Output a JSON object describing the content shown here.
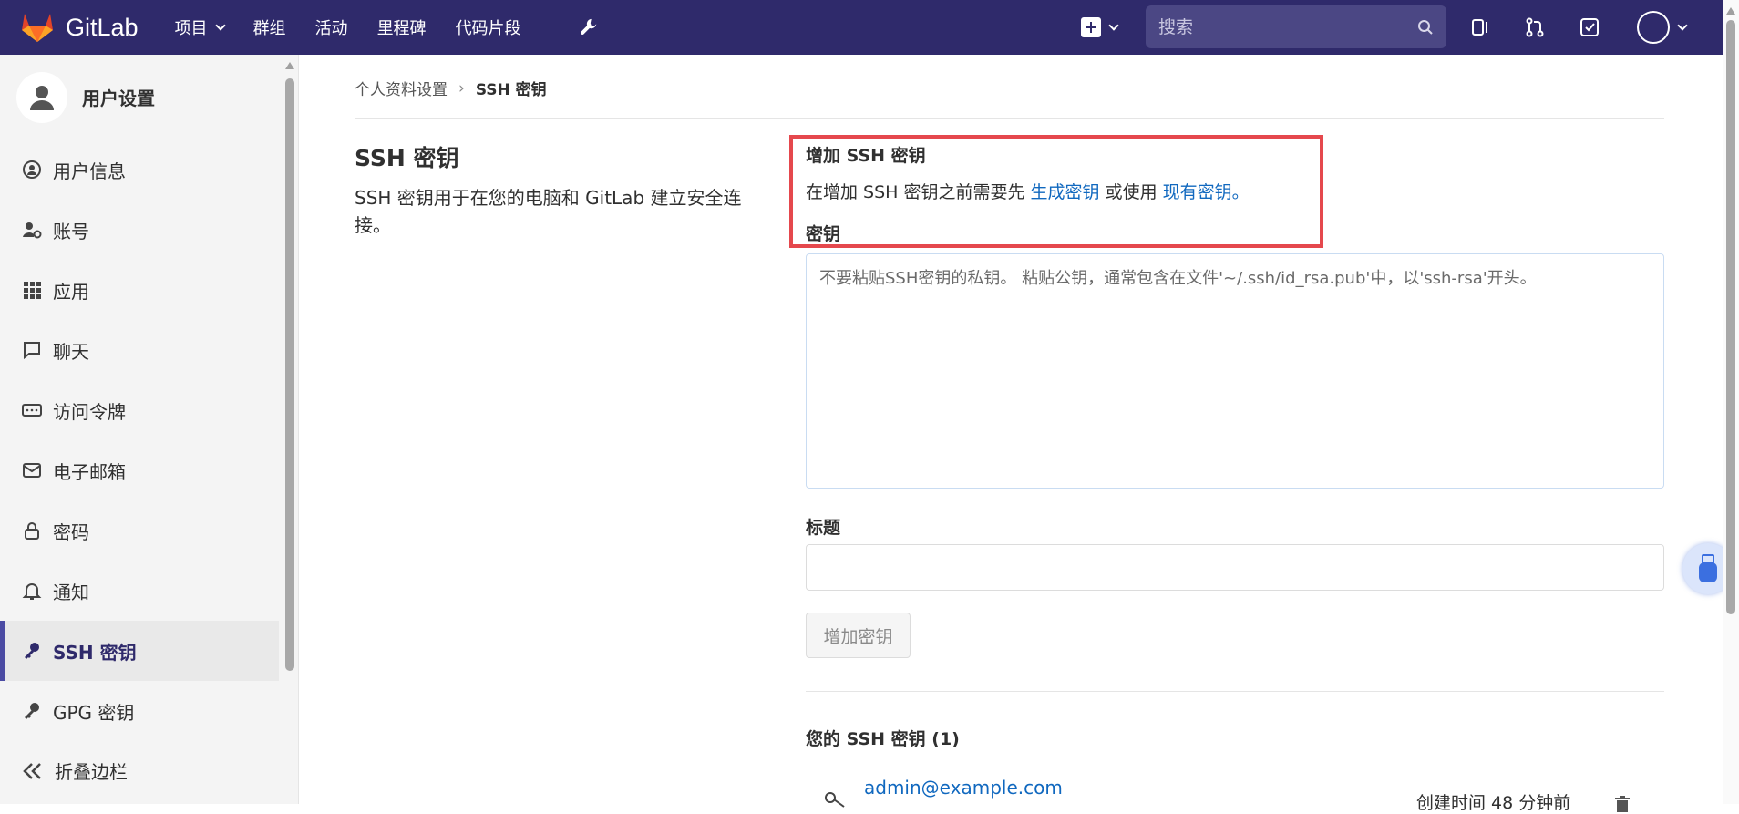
{
  "navbar": {
    "brand": "GitLab",
    "items": [
      "项目",
      "群组",
      "活动",
      "里程碑",
      "代码片段"
    ],
    "search_placeholder": "搜索"
  },
  "sidebar": {
    "title": "用户设置",
    "items": [
      {
        "label": "用户信息",
        "icon": "profile-icon"
      },
      {
        "label": "账号",
        "icon": "account-gear-icon"
      },
      {
        "label": "应用",
        "icon": "applications-grid-icon"
      },
      {
        "label": "聊天",
        "icon": "chat-icon"
      },
      {
        "label": "访问令牌",
        "icon": "token-icon"
      },
      {
        "label": "电子邮箱",
        "icon": "mail-icon"
      },
      {
        "label": "密码",
        "icon": "lock-icon"
      },
      {
        "label": "通知",
        "icon": "bell-icon"
      },
      {
        "label": "SSH 密钥",
        "icon": "key-icon",
        "active": true
      },
      {
        "label": "GPG 密钥",
        "icon": "key-icon"
      }
    ],
    "collapse_label": "折叠边栏"
  },
  "breadcrumb": {
    "parent": "个人资料设置",
    "current": "SSH 密钥"
  },
  "section": {
    "title": "SSH 密钥",
    "description": "SSH 密钥用于在您的电脑和 GitLab 建立安全连接。"
  },
  "form": {
    "add_title": "增加 SSH 密钥",
    "desc_prefix": "在增加 SSH 密钥之前需要先 ",
    "link_generate": "生成密钥",
    "desc_middle": " 或使用 ",
    "link_existing": "现有密钥。",
    "key_label": "密钥",
    "key_placeholder": "不要粘贴SSH密钥的私钥。 粘贴公钥，通常包含在文件'~/.ssh/id_rsa.pub'中，以'ssh-rsa'开头。",
    "title_label": "标题",
    "title_value": "",
    "add_button": "增加密钥"
  },
  "keys": {
    "heading": "您的 SSH 密钥 (1)",
    "items": [
      {
        "name": "admin@example.com",
        "created": "创建时间 48 分钟前"
      }
    ]
  },
  "colors": {
    "navbar_bg": "#2f2a6b",
    "link": "#1068bf",
    "highlight": "#e5484d"
  }
}
